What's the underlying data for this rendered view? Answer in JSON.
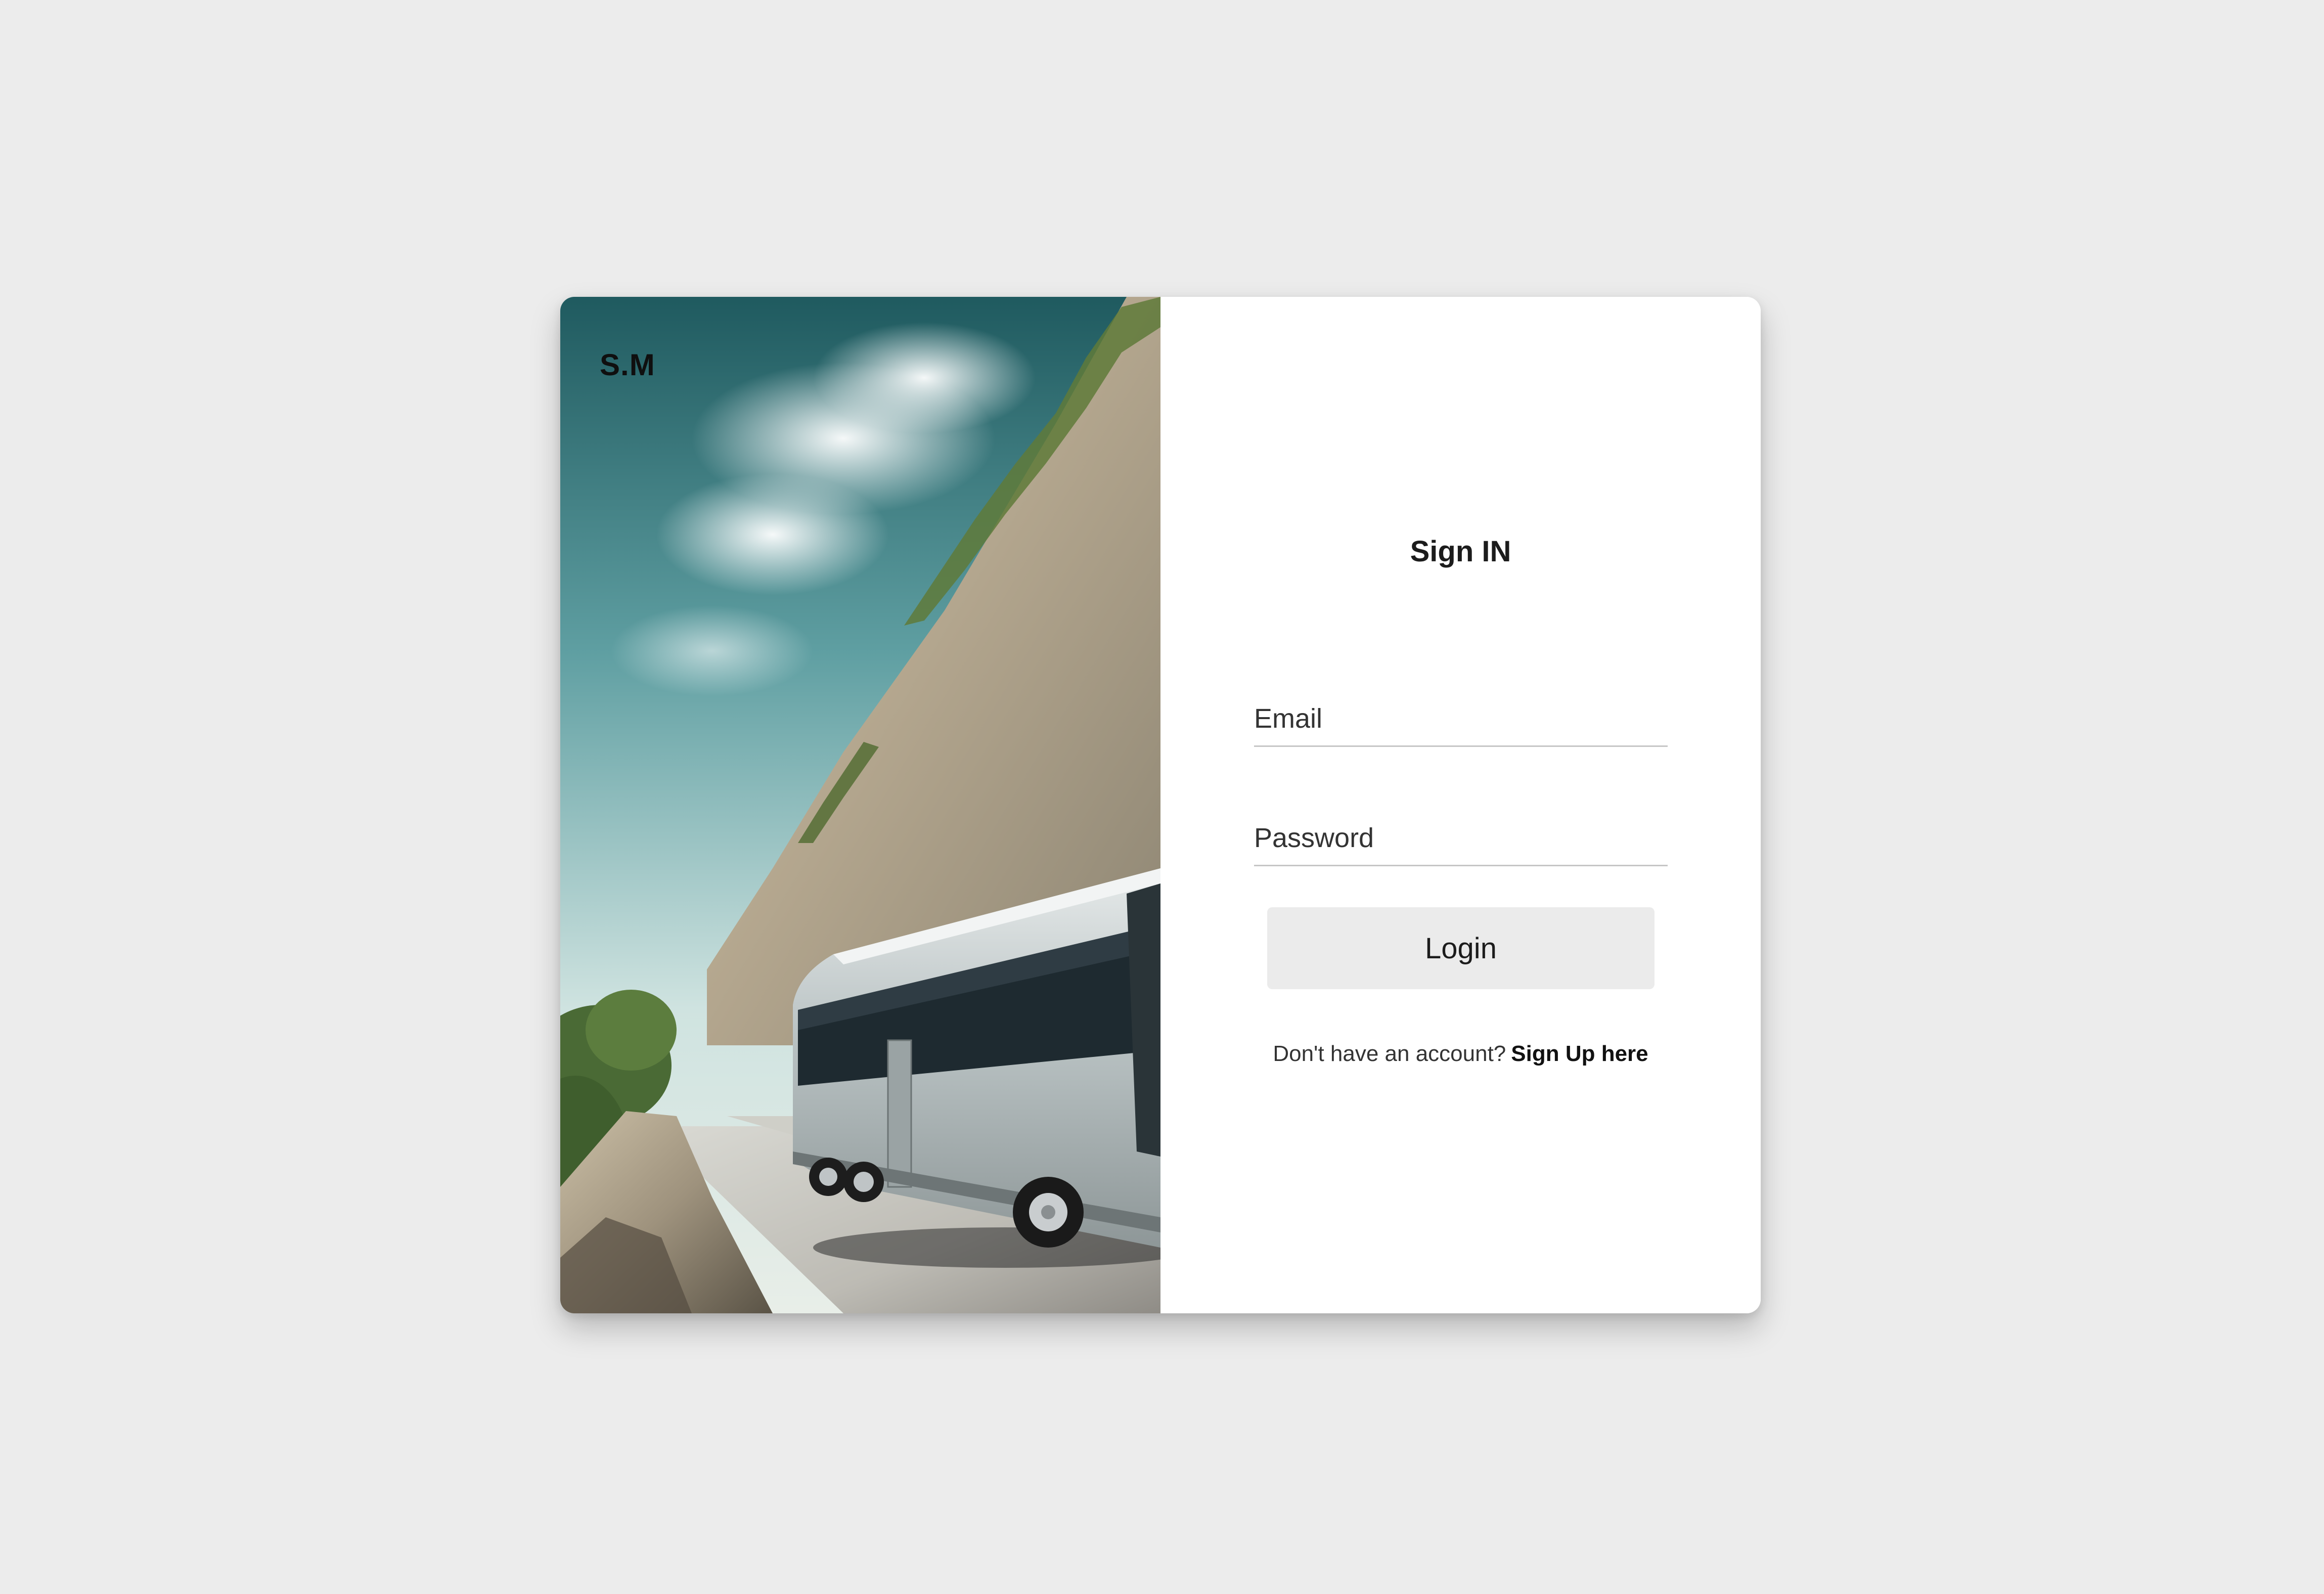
{
  "brand": {
    "logo_text": "S.M"
  },
  "hero": {
    "image": "bus-on-coastal-road"
  },
  "form": {
    "title": "Sign IN",
    "email_placeholder": "Email",
    "password_placeholder": "Password",
    "login_label": "Login",
    "signup_prompt": "Don't have an account?",
    "signup_link": "Sign Up here"
  },
  "colors": {
    "background": "#ececec",
    "card": "#ffffff",
    "button": "#ebebeb",
    "underline": "#c6c6c6"
  }
}
